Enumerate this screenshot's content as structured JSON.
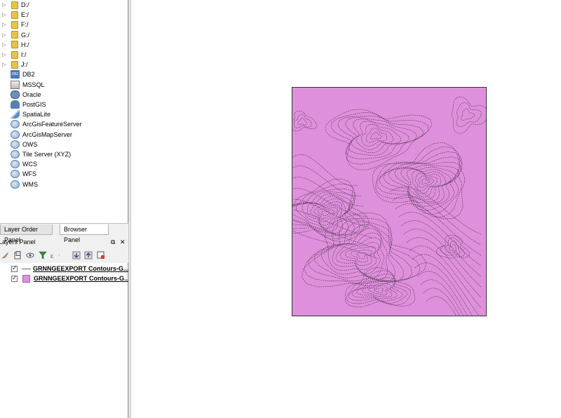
{
  "browser_panel": {
    "items": [
      {
        "label": "D:/",
        "icon": "folder-icon",
        "expandable": true
      },
      {
        "label": "E:/",
        "icon": "folder-icon",
        "expandable": true
      },
      {
        "label": "F:/",
        "icon": "folder-icon",
        "expandable": true
      },
      {
        "label": "G:/",
        "icon": "folder-icon",
        "expandable": true
      },
      {
        "label": "H:/",
        "icon": "folder-icon",
        "expandable": true
      },
      {
        "label": "I:/",
        "icon": "folder-icon",
        "expandable": true
      },
      {
        "label": "J:/",
        "icon": "folder-icon",
        "expandable": true
      },
      {
        "label": "DB2",
        "icon": "db2-icon",
        "expandable": false
      },
      {
        "label": "MSSQL",
        "icon": "mssql-icon",
        "expandable": false
      },
      {
        "label": "Oracle",
        "icon": "oracle-icon",
        "expandable": false
      },
      {
        "label": "PostGIS",
        "icon": "postgis-icon",
        "expandable": false
      },
      {
        "label": "SpatiaLite",
        "icon": "spatialite-icon",
        "expandable": false
      },
      {
        "label": "ArcGisFeatureServer",
        "icon": "arcgis-feature-icon",
        "expandable": false
      },
      {
        "label": "ArcGisMapServer",
        "icon": "arcgis-map-icon",
        "expandable": false
      },
      {
        "label": "OWS",
        "icon": "ows-icon",
        "expandable": false
      },
      {
        "label": "Tile Server (XYZ)",
        "icon": "xyz-icon",
        "expandable": false
      },
      {
        "label": "WCS",
        "icon": "wcs-icon",
        "expandable": false
      },
      {
        "label": "WFS",
        "icon": "wfs-icon",
        "expandable": false
      },
      {
        "label": "WMS",
        "icon": "wms-icon",
        "expandable": false
      }
    ],
    "db2_badge": "DB2"
  },
  "tabs": [
    {
      "label": "Layer Order Panel",
      "active": false
    },
    {
      "label": "Browser Panel",
      "active": true
    }
  ],
  "layers_panel": {
    "title": "Layers Panel",
    "float_icon": "⧉",
    "close_icon": "✕",
    "layers": [
      {
        "name": "GRNNGEEXPORT Contours-G...",
        "checked": true,
        "symbol": "line"
      },
      {
        "name": "GRNNGEEXPORT Contours-G...",
        "checked": true,
        "symbol": "fill"
      }
    ]
  },
  "map": {
    "fill_color": "#df90dc",
    "line_color": "#5a3a5a"
  }
}
